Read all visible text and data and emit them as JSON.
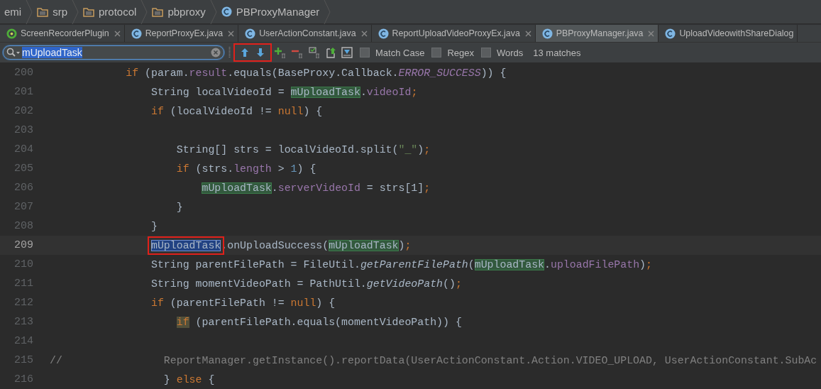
{
  "breadcrumbs": [
    {
      "label": "emi",
      "kind": "text"
    },
    {
      "label": "srp",
      "kind": "folder"
    },
    {
      "label": "protocol",
      "kind": "folder"
    },
    {
      "label": "pbproxy",
      "kind": "folder"
    },
    {
      "label": "PBProxyManager",
      "kind": "class"
    }
  ],
  "tabs": [
    {
      "label": "ScreenRecorderPlugin",
      "kind": "plugin",
      "selected": false
    },
    {
      "label": "ReportProxyEx.java",
      "kind": "class",
      "selected": false
    },
    {
      "label": "UserActionConstant.java",
      "kind": "class",
      "selected": false
    },
    {
      "label": "ReportUploadVideoProxyEx.java",
      "kind": "class",
      "selected": false
    },
    {
      "label": "PBProxyManager.java",
      "kind": "class",
      "selected": true
    },
    {
      "label": "UploadVideowithShareDialog",
      "kind": "class",
      "selected": false
    }
  ],
  "find_bar": {
    "query": "mUploadTask",
    "nav_marked": true,
    "options": [
      {
        "label": "Match Case",
        "checked": false
      },
      {
        "label": "Regex",
        "checked": false
      },
      {
        "label": "Words",
        "checked": false
      }
    ],
    "match_count": "13 matches"
  },
  "editor": {
    "lines": [
      {
        "number": "200",
        "current": false,
        "tokens": [
          {
            "text": "            if",
            "kind": "keyword"
          },
          {
            "text": " (param.",
            "kind": "plain"
          },
          {
            "text": "result",
            "kind": "field"
          },
          {
            "text": ".equals(BaseProxy.Callback.",
            "kind": "plain"
          },
          {
            "text": "ERROR_SUCCESS",
            "kind": "static"
          },
          {
            "text": ")) {",
            "kind": "plain"
          }
        ]
      },
      {
        "number": "201",
        "current": false,
        "tokens": [
          {
            "text": "                String localVideoId = ",
            "kind": "plain"
          },
          {
            "text": "mUploadTask",
            "kind": "match"
          },
          {
            "text": ".",
            "kind": "plain"
          },
          {
            "text": "videoId",
            "kind": "field"
          },
          {
            "text": ";",
            "kind": "punct"
          }
        ]
      },
      {
        "number": "202",
        "current": false,
        "tokens": [
          {
            "text": "                if",
            "kind": "keyword"
          },
          {
            "text": " (localVideoId != ",
            "kind": "plain"
          },
          {
            "text": "null",
            "kind": "keyword"
          },
          {
            "text": ") {",
            "kind": "plain"
          }
        ]
      },
      {
        "number": "203",
        "current": false
      },
      {
        "number": "204",
        "current": false,
        "tokens": [
          {
            "text": "                    String[] strs = localVideoId.split(",
            "kind": "plain"
          },
          {
            "text": "\"_\"",
            "kind": "string"
          },
          {
            "text": ")",
            "kind": "plain"
          },
          {
            "text": ";",
            "kind": "punct"
          }
        ]
      },
      {
        "number": "205",
        "current": false,
        "tokens": [
          {
            "text": "                    if",
            "kind": "keyword"
          },
          {
            "text": " (strs.",
            "kind": "plain"
          },
          {
            "text": "length",
            "kind": "field"
          },
          {
            "text": " > ",
            "kind": "plain"
          },
          {
            "text": "1",
            "kind": "number"
          },
          {
            "text": ") {",
            "kind": "plain"
          }
        ]
      },
      {
        "number": "206",
        "current": false,
        "tokens": [
          {
            "text": "                        mUploadTask",
            "kind": "match"
          },
          {
            "text": ".",
            "kind": "plain"
          },
          {
            "text": "serverVideoId",
            "kind": "field"
          },
          {
            "text": " = strs[1]",
            "kind": "plain"
          },
          {
            "text": ";",
            "kind": "punct"
          }
        ]
      },
      {
        "number": "207",
        "current": false,
        "tokens": [
          {
            "text": "                    }",
            "kind": "plain"
          }
        ]
      },
      {
        "number": "208",
        "current": false,
        "tokens": [
          {
            "text": "                }",
            "kind": "plain"
          }
        ]
      },
      {
        "number": "209",
        "current": true,
        "tokens": [
          {
            "text": "                mUploadTask",
            "kind": "current-match"
          },
          {
            "text": ".onUploadSuccess(",
            "kind": "plain"
          },
          {
            "text": "mUploadTask",
            "kind": "match"
          },
          {
            "text": ")",
            "kind": "plain"
          },
          {
            "text": ";",
            "kind": "punct"
          }
        ]
      },
      {
        "number": "210",
        "current": false,
        "tokens": [
          {
            "text": "                String parentFilePath = FileUtil.",
            "kind": "plain"
          },
          {
            "text": "getParentFilePath",
            "kind": "static-method"
          },
          {
            "text": "(",
            "kind": "plain"
          },
          {
            "text": "mUploadTask",
            "kind": "match"
          },
          {
            "text": ".",
            "kind": "plain"
          },
          {
            "text": "uploadFilePath",
            "kind": "field"
          },
          {
            "text": ")",
            "kind": "plain"
          },
          {
            "text": ";",
            "kind": "punct"
          }
        ]
      },
      {
        "number": "211",
        "current": false,
        "tokens": [
          {
            "text": "                String momentVideoPath = PathUtil.",
            "kind": "plain"
          },
          {
            "text": "getVideoPath",
            "kind": "static-method"
          },
          {
            "text": "()",
            "kind": "plain"
          },
          {
            "text": ";",
            "kind": "punct"
          }
        ]
      },
      {
        "number": "212",
        "current": false,
        "tokens": [
          {
            "text": "                if",
            "kind": "keyword"
          },
          {
            "text": " (parentFilePath != ",
            "kind": "plain"
          },
          {
            "text": "null",
            "kind": "keyword"
          },
          {
            "text": ") {",
            "kind": "plain"
          }
        ]
      },
      {
        "number": "213",
        "current": false,
        "tokens": [
          {
            "text": "                    if",
            "kind": "keyword-mark"
          },
          {
            "text": " (parentFilePath.equals(momentVideoPath)) {",
            "kind": "plain"
          }
        ]
      },
      {
        "number": "214",
        "current": false
      },
      {
        "number": "215",
        "current": false,
        "tokens": [
          {
            "text": "//                ReportManager.getInstance().reportData(UserActionConstant.Action.VIDEO_UPLOAD, UserActionConstant.SubAc",
            "kind": "comment"
          }
        ]
      },
      {
        "number": "216",
        "current": false,
        "tokens": [
          {
            "text": "                  } ",
            "kind": "plain"
          },
          {
            "text": "else",
            "kind": "keyword"
          },
          {
            "text": " {",
            "kind": "plain"
          }
        ]
      }
    ]
  }
}
